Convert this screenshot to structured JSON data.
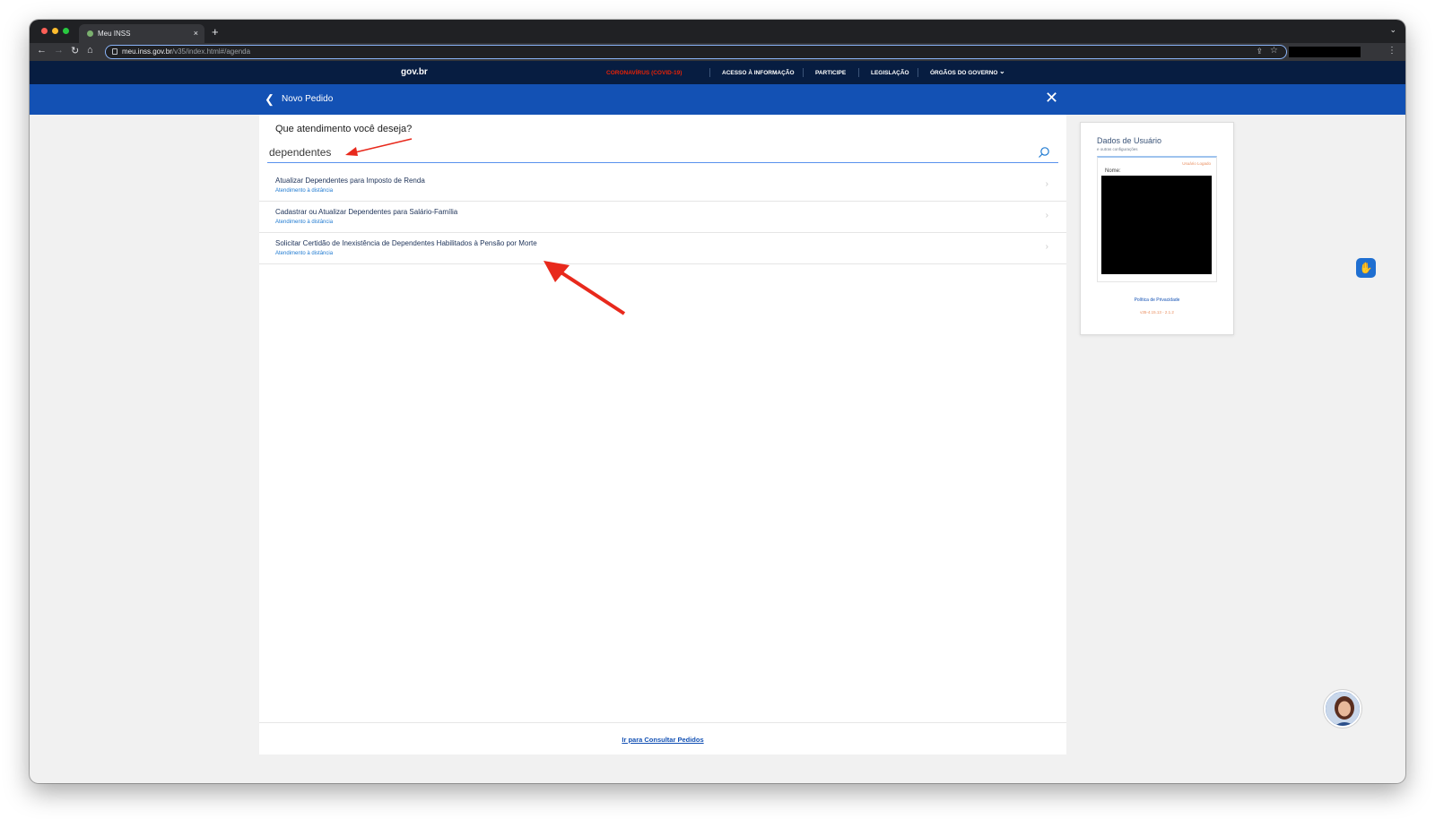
{
  "browser": {
    "tab_title": "Meu INSS",
    "tab_close": "×",
    "new_tab": "+",
    "url_host": "meu.inss.gov.br",
    "url_path": "/v35/index.html#/agenda"
  },
  "govbar": {
    "logo": "gov.br",
    "links": [
      "CORONAVÍRUS (COVID-19)",
      "ACESSO À INFORMAÇÃO",
      "PARTICIPE",
      "LEGISLAÇÃO",
      "ÓRGÃOS DO GOVERNO"
    ]
  },
  "header": {
    "title": "Novo Pedido"
  },
  "search": {
    "question": "Que atendimento você deseja?",
    "value": "dependentes"
  },
  "results": [
    {
      "title": "Atualizar Dependentes para Imposto de Renda",
      "subtitle": "Atendimento à distância"
    },
    {
      "title": "Cadastrar ou Atualizar Dependentes para Salário-Família",
      "subtitle": "Atendimento à distância"
    },
    {
      "title": "Solicitar Certidão de Inexistência de Dependentes Habilitados à Pensão por Morte",
      "subtitle": "Atendimento à distância"
    }
  ],
  "footer": {
    "link": "Ir para Consultar Pedidos"
  },
  "user_card": {
    "title": "Dados de Usuário",
    "subtitle": "e outras configurações",
    "logged": "Usuário Logado",
    "name_label": "Nome:",
    "privacy": "Política de Privacidade",
    "version": "v35-4.15.13 - 2.1.2"
  },
  "colors": {
    "gov_dark": "#071d41",
    "header_blue": "#1351b4",
    "annotation_red": "#e8291c"
  }
}
